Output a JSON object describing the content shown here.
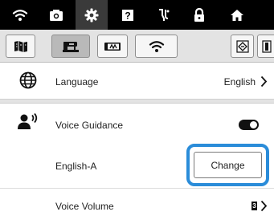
{
  "topbar": {
    "icons": [
      "wifi-icon",
      "camera-icon",
      "settings-gear-icon",
      "help-icon",
      "sewing-pin-icon",
      "lock-icon",
      "home-icon"
    ],
    "active": "settings-gear-icon"
  },
  "tabs": {
    "items": [
      "pattern-book-icon",
      "sewing-machine-icon",
      "embroidery-frame-icon",
      "wireless-icon",
      "pattern-icon",
      "page-icon"
    ],
    "selected": "sewing-machine-icon"
  },
  "language": {
    "label": "Language",
    "value": "English"
  },
  "voice_guidance": {
    "label": "Voice Guidance",
    "toggle_on": true
  },
  "voice_type": {
    "label": "English-A",
    "button_label": "Change"
  },
  "voice_volume": {
    "label": "Voice Volume",
    "value": "3"
  },
  "colors": {
    "highlight": "#2a8cd9",
    "topbar": "#000000",
    "tabstrip": "#e3e3e3"
  }
}
